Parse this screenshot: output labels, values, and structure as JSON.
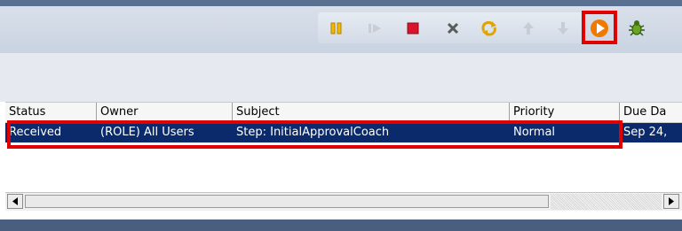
{
  "toolbar": {
    "icons": [
      "pause-icon",
      "step-forward-icon",
      "stop-icon",
      "cancel-icon",
      "refresh-icon",
      "up-arrow-icon",
      "down-arrow-icon",
      "run-icon",
      "debug-bug-icon"
    ]
  },
  "table": {
    "columns": [
      "Status",
      "Owner",
      "Subject",
      "Priority",
      "Due Da"
    ],
    "rows": [
      {
        "status": "Received",
        "owner": "(ROLE) All Users",
        "subject": "Step: InitialApprovalCoach",
        "priority": "Normal",
        "due_date": "Sep 24,"
      }
    ]
  },
  "colors": {
    "selected_row": "#0a2a6b",
    "highlight": "#e00000",
    "stop": "#d9142b",
    "run": "#f07a00"
  }
}
